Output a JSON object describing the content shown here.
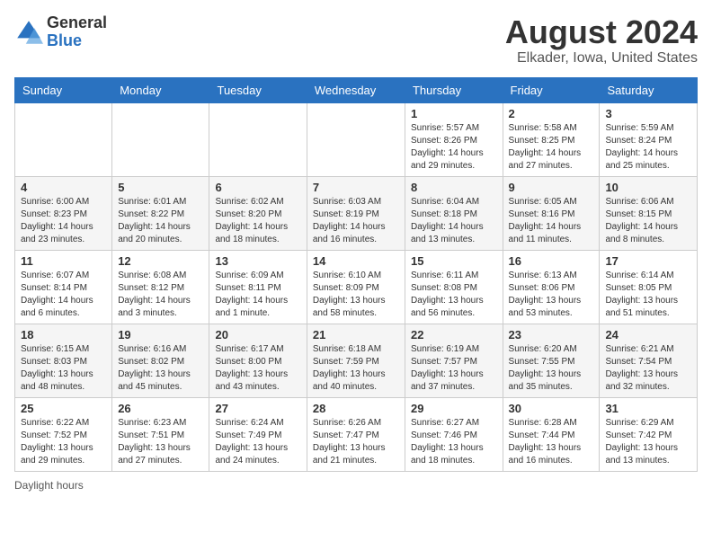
{
  "header": {
    "logo_general": "General",
    "logo_blue": "Blue",
    "month_year": "August 2024",
    "location": "Elkader, Iowa, United States"
  },
  "days_of_week": [
    "Sunday",
    "Monday",
    "Tuesday",
    "Wednesday",
    "Thursday",
    "Friday",
    "Saturday"
  ],
  "weeks": [
    [
      {
        "day": "",
        "info": ""
      },
      {
        "day": "",
        "info": ""
      },
      {
        "day": "",
        "info": ""
      },
      {
        "day": "",
        "info": ""
      },
      {
        "day": "1",
        "info": "Sunrise: 5:57 AM\nSunset: 8:26 PM\nDaylight: 14 hours and 29 minutes."
      },
      {
        "day": "2",
        "info": "Sunrise: 5:58 AM\nSunset: 8:25 PM\nDaylight: 14 hours and 27 minutes."
      },
      {
        "day": "3",
        "info": "Sunrise: 5:59 AM\nSunset: 8:24 PM\nDaylight: 14 hours and 25 minutes."
      }
    ],
    [
      {
        "day": "4",
        "info": "Sunrise: 6:00 AM\nSunset: 8:23 PM\nDaylight: 14 hours and 23 minutes."
      },
      {
        "day": "5",
        "info": "Sunrise: 6:01 AM\nSunset: 8:22 PM\nDaylight: 14 hours and 20 minutes."
      },
      {
        "day": "6",
        "info": "Sunrise: 6:02 AM\nSunset: 8:20 PM\nDaylight: 14 hours and 18 minutes."
      },
      {
        "day": "7",
        "info": "Sunrise: 6:03 AM\nSunset: 8:19 PM\nDaylight: 14 hours and 16 minutes."
      },
      {
        "day": "8",
        "info": "Sunrise: 6:04 AM\nSunset: 8:18 PM\nDaylight: 14 hours and 13 minutes."
      },
      {
        "day": "9",
        "info": "Sunrise: 6:05 AM\nSunset: 8:16 PM\nDaylight: 14 hours and 11 minutes."
      },
      {
        "day": "10",
        "info": "Sunrise: 6:06 AM\nSunset: 8:15 PM\nDaylight: 14 hours and 8 minutes."
      }
    ],
    [
      {
        "day": "11",
        "info": "Sunrise: 6:07 AM\nSunset: 8:14 PM\nDaylight: 14 hours and 6 minutes."
      },
      {
        "day": "12",
        "info": "Sunrise: 6:08 AM\nSunset: 8:12 PM\nDaylight: 14 hours and 3 minutes."
      },
      {
        "day": "13",
        "info": "Sunrise: 6:09 AM\nSunset: 8:11 PM\nDaylight: 14 hours and 1 minute."
      },
      {
        "day": "14",
        "info": "Sunrise: 6:10 AM\nSunset: 8:09 PM\nDaylight: 13 hours and 58 minutes."
      },
      {
        "day": "15",
        "info": "Sunrise: 6:11 AM\nSunset: 8:08 PM\nDaylight: 13 hours and 56 minutes."
      },
      {
        "day": "16",
        "info": "Sunrise: 6:13 AM\nSunset: 8:06 PM\nDaylight: 13 hours and 53 minutes."
      },
      {
        "day": "17",
        "info": "Sunrise: 6:14 AM\nSunset: 8:05 PM\nDaylight: 13 hours and 51 minutes."
      }
    ],
    [
      {
        "day": "18",
        "info": "Sunrise: 6:15 AM\nSunset: 8:03 PM\nDaylight: 13 hours and 48 minutes."
      },
      {
        "day": "19",
        "info": "Sunrise: 6:16 AM\nSunset: 8:02 PM\nDaylight: 13 hours and 45 minutes."
      },
      {
        "day": "20",
        "info": "Sunrise: 6:17 AM\nSunset: 8:00 PM\nDaylight: 13 hours and 43 minutes."
      },
      {
        "day": "21",
        "info": "Sunrise: 6:18 AM\nSunset: 7:59 PM\nDaylight: 13 hours and 40 minutes."
      },
      {
        "day": "22",
        "info": "Sunrise: 6:19 AM\nSunset: 7:57 PM\nDaylight: 13 hours and 37 minutes."
      },
      {
        "day": "23",
        "info": "Sunrise: 6:20 AM\nSunset: 7:55 PM\nDaylight: 13 hours and 35 minutes."
      },
      {
        "day": "24",
        "info": "Sunrise: 6:21 AM\nSunset: 7:54 PM\nDaylight: 13 hours and 32 minutes."
      }
    ],
    [
      {
        "day": "25",
        "info": "Sunrise: 6:22 AM\nSunset: 7:52 PM\nDaylight: 13 hours and 29 minutes."
      },
      {
        "day": "26",
        "info": "Sunrise: 6:23 AM\nSunset: 7:51 PM\nDaylight: 13 hours and 27 minutes."
      },
      {
        "day": "27",
        "info": "Sunrise: 6:24 AM\nSunset: 7:49 PM\nDaylight: 13 hours and 24 minutes."
      },
      {
        "day": "28",
        "info": "Sunrise: 6:26 AM\nSunset: 7:47 PM\nDaylight: 13 hours and 21 minutes."
      },
      {
        "day": "29",
        "info": "Sunrise: 6:27 AM\nSunset: 7:46 PM\nDaylight: 13 hours and 18 minutes."
      },
      {
        "day": "30",
        "info": "Sunrise: 6:28 AM\nSunset: 7:44 PM\nDaylight: 13 hours and 16 minutes."
      },
      {
        "day": "31",
        "info": "Sunrise: 6:29 AM\nSunset: 7:42 PM\nDaylight: 13 hours and 13 minutes."
      }
    ]
  ],
  "footer": {
    "note": "Daylight hours"
  }
}
